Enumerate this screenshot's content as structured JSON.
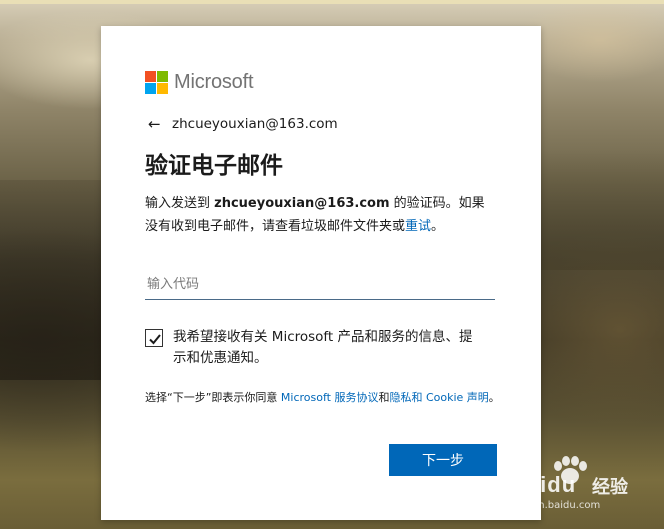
{
  "logo": {
    "text": "Microsoft",
    "colors": [
      "#f25022",
      "#7fba00",
      "#00a4ef",
      "#ffb900"
    ]
  },
  "identity": {
    "back_icon": "back-arrow-icon",
    "email": "zhcueyouxian@163.com"
  },
  "page": {
    "title": "验证电子邮件"
  },
  "description": {
    "prefix": "输入发送到 ",
    "email": "zhcueyouxian@163.com",
    "middle": " 的验证码。如果没有收到电子邮件，请查看垃圾邮件文件夹或",
    "retry_link": "重试",
    "suffix": "。"
  },
  "code_input": {
    "placeholder": "输入代码",
    "value": ""
  },
  "consent": {
    "checked": true,
    "label": "我希望接收有关 Microsoft 产品和服务的信息、提示和优惠通知。"
  },
  "terms": {
    "prefix": "选择“下一步”即表示你同意 ",
    "agreement_link": "Microsoft 服务协议",
    "and": "和",
    "privacy_link": "隐私和 Cookie 声明",
    "suffix": "。"
  },
  "actions": {
    "next_label": "下一步"
  },
  "colors": {
    "accent": "#0067b8",
    "text": "#1b1b1b",
    "card": "#ffffff"
  },
  "watermark": {
    "brand": "Bai",
    "brand2": "du",
    "cn": "经验",
    "url": "jingyan.baidu.com"
  }
}
